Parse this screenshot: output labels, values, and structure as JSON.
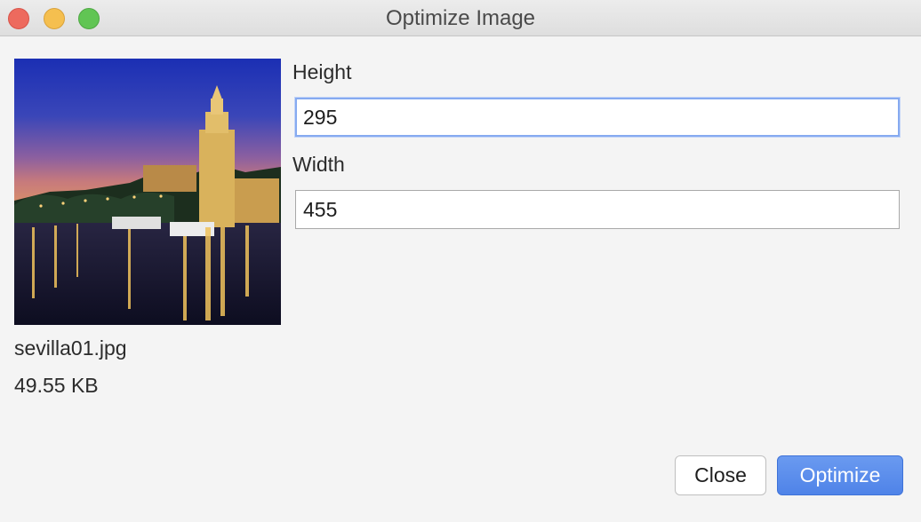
{
  "window": {
    "title": "Optimize Image"
  },
  "image": {
    "file_name": "sevilla01.jpg",
    "file_size": "49.55 KB"
  },
  "form": {
    "height_label": "Height",
    "height_value": "295",
    "width_label": "Width",
    "width_value": "455"
  },
  "buttons": {
    "close_label": "Close",
    "optimize_label": "Optimize"
  },
  "colors": {
    "accent": "#5588ec",
    "focus_ring": "#86aaf0",
    "traffic_close": "#ed6a5e",
    "traffic_minimize": "#f5bf4f",
    "traffic_maximize": "#61c554"
  }
}
